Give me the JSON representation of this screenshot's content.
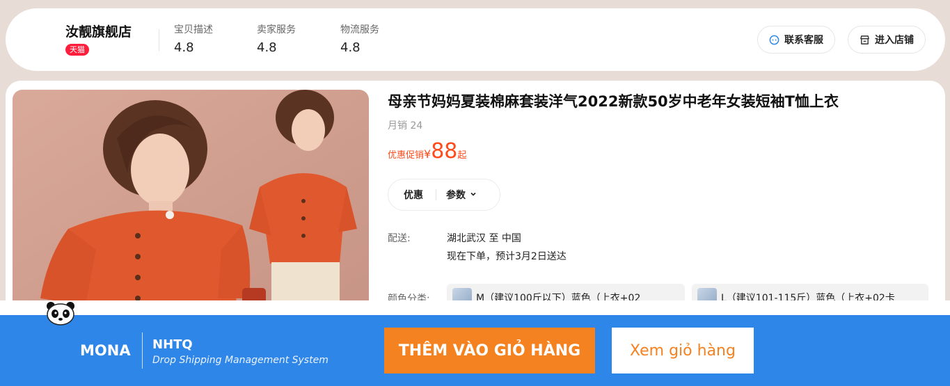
{
  "store": {
    "name": "汝靓旗舰店",
    "badge": "天猫",
    "ratings": [
      {
        "label": "宝贝描述",
        "value": "4.8"
      },
      {
        "label": "卖家服务",
        "value": "4.8"
      },
      {
        "label": "物流服务",
        "value": "4.8"
      }
    ],
    "contact_button": "联系客服",
    "enter_store_button": "进入店铺"
  },
  "product": {
    "title": "母亲节妈妈夏装棉麻套装洋气2022新款50岁中老年女装短袖T恤上衣",
    "monthly_sales": "月销 24",
    "price": {
      "promo_label": "优惠促销",
      "currency": "¥",
      "amount": "88",
      "suffix": "起"
    },
    "tabs": [
      {
        "label": "优惠"
      },
      {
        "label": "参数"
      }
    ],
    "shipping": {
      "label": "配送:",
      "route": "湖北武汉 至 中国",
      "eta": "现在下单，预计3月2日送达"
    },
    "color_label": "颜色分类:",
    "skus": [
      {
        "label": "M（建议100斤以下）蓝色（上衣+02"
      },
      {
        "label": "L（建议101-115斤）蓝色（上衣+02卡"
      }
    ]
  },
  "toolbar": {
    "brand": "MONA",
    "product_name": "NHTQ",
    "tagline": "Drop Shipping Management System",
    "add_to_cart": "THÊM VÀO GIỎ HÀNG",
    "view_cart": "Xem giỏ hàng"
  },
  "colors": {
    "accent_price": "#ff4a1a",
    "bar_blue": "#2f86e9",
    "button_orange": "#f58220",
    "tmall_red": "#ff1e3c"
  }
}
